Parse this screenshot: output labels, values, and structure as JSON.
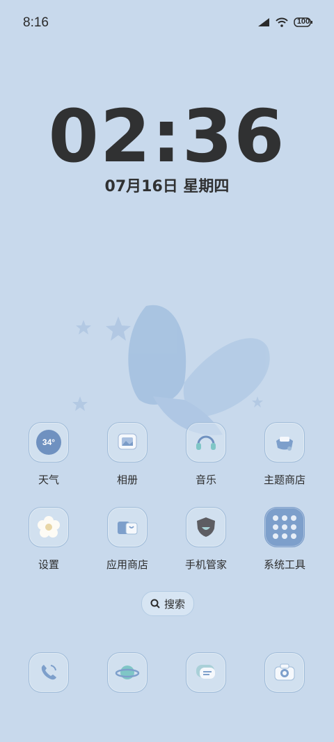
{
  "status_bar": {
    "time": "8:16",
    "battery": "100",
    "icons": [
      "signal-icon",
      "wifi-icon",
      "battery-icon"
    ]
  },
  "lock_clock": {
    "time": "02:36",
    "date": "07月16日 星期四"
  },
  "apps_row1": [
    {
      "label": "天气",
      "icon": "weather-icon",
      "icon_text": "34°"
    },
    {
      "label": "相册",
      "icon": "gallery-icon"
    },
    {
      "label": "音乐",
      "icon": "music-icon"
    },
    {
      "label": "主题商店",
      "icon": "theme-store-icon"
    }
  ],
  "apps_row2": [
    {
      "label": "设置",
      "icon": "settings-icon"
    },
    {
      "label": "应用商店",
      "icon": "app-store-icon"
    },
    {
      "label": "手机管家",
      "icon": "phone-manager-icon"
    },
    {
      "label": "系统工具",
      "icon": "system-tools-folder-icon"
    }
  ],
  "search": {
    "label": "搜索"
  },
  "dock": [
    "phone-icon",
    "browser-icon",
    "messages-icon",
    "camera-icon"
  ],
  "colors": {
    "background": "#c8d9ec",
    "icon_border": "#9fbbd8",
    "accent_blue": "#7d9fcb",
    "text": "#2d2d2d"
  }
}
